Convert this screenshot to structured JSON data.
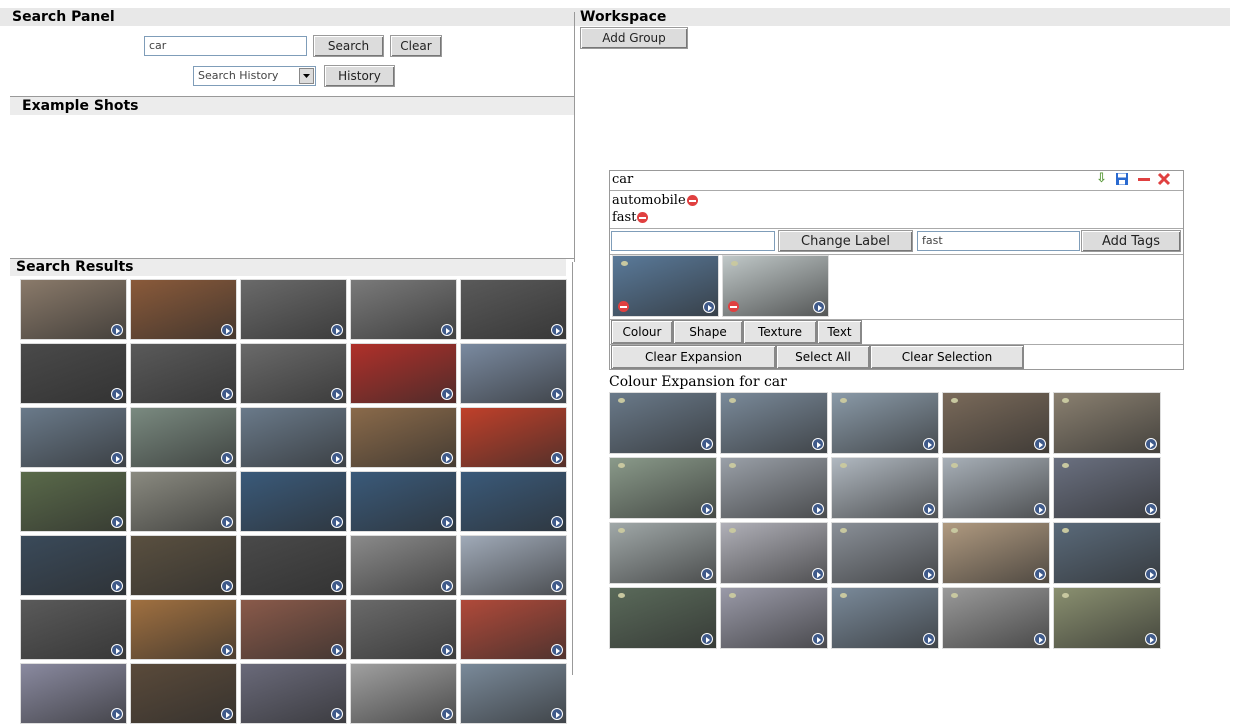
{
  "search_panel": {
    "title": "Search Panel",
    "query_value": "car",
    "search_label": "Search",
    "clear_label": "Clear",
    "history_select_value": "Search History",
    "history_label": "History"
  },
  "example_shots": {
    "title": "Example Shots"
  },
  "search_results": {
    "title": "Search Results",
    "thumbs": [
      "#8a7a6a",
      "#8a5a3a",
      "#6a6a6a",
      "#7a7a7a",
      "#5a5a5a",
      "#4a4a4a",
      "#5a5a5a",
      "#6a6a6a",
      "#b0302a",
      "#7a8aa0",
      "#6a7a8a",
      "#7a8a80",
      "#6a7a8a",
      "#8a6a4a",
      "#c0402a",
      "#5a6a4a",
      "#8a8a80",
      "#3a5a7a",
      "#3a5a7a",
      "#3a5a7a",
      "#3a4a5a",
      "#5a5040",
      "#4a4a4a",
      "#8a8a8a",
      "#a0aab8",
      "#5a5a5a",
      "#a07040",
      "#8a5a4a",
      "#6a6a6a",
      "#b04a3a",
      "#8a8aa0",
      "#5a4a3a",
      "#6a6a7a",
      "#a0a0a0",
      "#7a8a9a"
    ]
  },
  "workspace": {
    "title": "Workspace",
    "add_group_label": "Add Group",
    "group": {
      "label": "car",
      "icons": [
        "download-icon",
        "save-icon",
        "minimize-icon",
        "close-icon"
      ],
      "tags": [
        "automobile",
        "fast"
      ],
      "label_input_value": "",
      "change_label": "Change Label",
      "tag_input_value": "fast",
      "add_tags_label": "Add Tags",
      "example_thumbs": [
        "#5a7a9a",
        "#c0c8c8"
      ],
      "feature_tabs": [
        "Colour",
        "Shape",
        "Texture",
        "Text"
      ],
      "actions": [
        "Clear Expansion",
        "Select All",
        "Clear Selection"
      ]
    },
    "expansion_title": "Colour Expansion for car",
    "expansion_thumbs": [
      "#6a7a8a",
      "#7a8a9a",
      "#8a9aa8",
      "#7a6a5a",
      "#8a8070",
      "#8a9a8a",
      "#9aa0a8",
      "#b0b8c0",
      "#a8b0b8",
      "#6a7080",
      "#a0a8a8",
      "#b0b0b8",
      "#8a9098",
      "#b09a80",
      "#5a6a7a",
      "#5a6a5a",
      "#9a9aa8",
      "#7a8a9a",
      "#9a9a9a",
      "#8a9070"
    ]
  },
  "colors": {
    "header_bg": "#e8e8e8",
    "button_bg": "#dcdcdc",
    "remove_red": "#e04040",
    "play_blue": "#3f5a8a"
  }
}
